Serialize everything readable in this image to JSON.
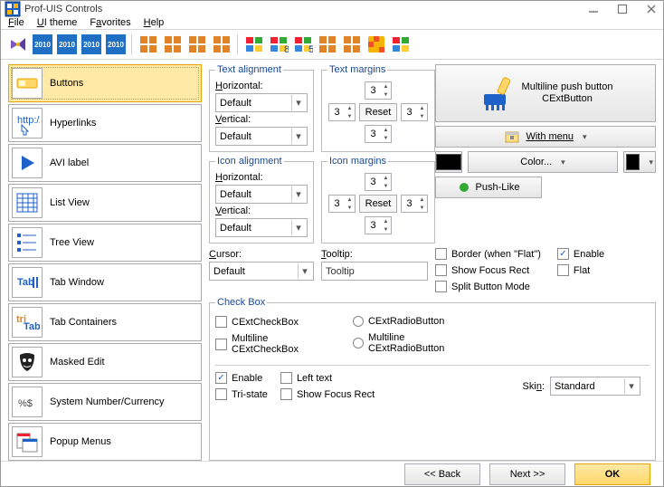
{
  "window": {
    "title": "Prof-UIS Controls"
  },
  "menu": {
    "file": "File",
    "uitheme": "UI theme",
    "favorites": "Favorites",
    "help": "Help"
  },
  "sidebar": {
    "items": [
      {
        "label": "Buttons"
      },
      {
        "label": "Hyperlinks"
      },
      {
        "label": "AVI label"
      },
      {
        "label": "List View"
      },
      {
        "label": "Tree View"
      },
      {
        "label": "Tab Window"
      },
      {
        "label": "Tab Containers"
      },
      {
        "label": "Masked Edit"
      },
      {
        "label": "System Number/Currency"
      },
      {
        "label": "Popup Menus"
      }
    ]
  },
  "textAlign": {
    "legend": "Text alignment",
    "hl": "Horizontal:",
    "hv": "Default",
    "vl": "Vertical:",
    "vv": "Default"
  },
  "textMargins": {
    "legend": "Text margins",
    "top": "3",
    "left": "3",
    "right": "3",
    "bottom": "3",
    "reset": "Reset"
  },
  "iconAlign": {
    "legend": "Icon alignment",
    "hl": "Horizontal:",
    "hv": "Default",
    "vl": "Vertical:",
    "vv": "Default"
  },
  "iconMargins": {
    "legend": "Icon margins",
    "top": "3",
    "left": "3",
    "right": "3",
    "bottom": "3",
    "reset": "Reset"
  },
  "cursor": {
    "label": "Cursor:",
    "value": "Default"
  },
  "tooltip": {
    "label": "Tooltip:",
    "value": "Tooltip"
  },
  "pushBtn": {
    "line1": "Multiline push button",
    "line2": "CExtButton"
  },
  "withMenu": "With menu",
  "colorBtn": "Color...",
  "pushLike": "Push-Like",
  "chk": {
    "border": "Border (when \"Flat\")",
    "focus": "Show Focus Rect",
    "split": "Split Button Mode",
    "enable": "Enable",
    "flat": "Flat"
  },
  "checkbox": {
    "legend": "Check Box",
    "c1": "CExtCheckBox",
    "c2": "Multiline\nCExtCheckBox",
    "r1": "CExtRadioButton",
    "r2": "Multiline\nCExtRadioButton",
    "enable": "Enable",
    "tristate": "Tri-state",
    "lefttext": "Left text",
    "showfocus": "Show Focus Rect",
    "skin": "Skin:",
    "skinval": "Standard"
  },
  "footer": {
    "back": "<< Back",
    "next": "Next >>",
    "ok": "OK"
  }
}
